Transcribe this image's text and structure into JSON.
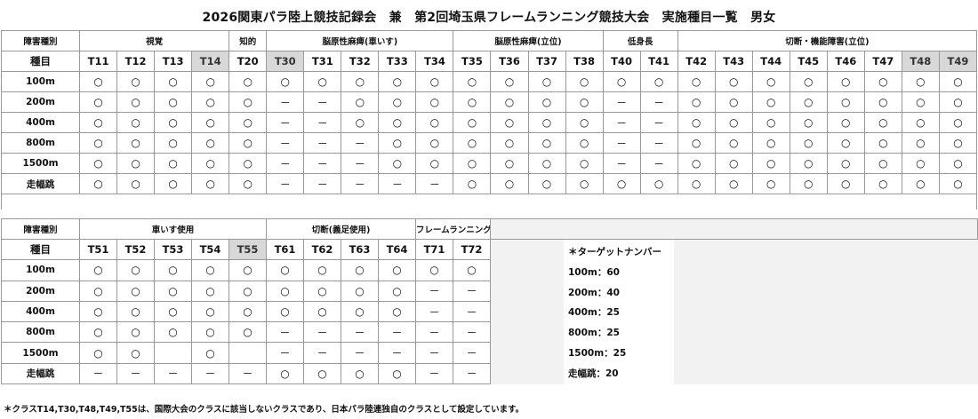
{
  "title": "2026関東パラ陸上競技記録会　兼　第2回埼玉県フレームランニング競技大会　実施種目一覧　男女",
  "labels": {
    "disability_type": "障害種別",
    "event": "種目"
  },
  "marks": {
    "yes": "○",
    "no": "－"
  },
  "table1": {
    "groups": [
      {
        "label": "視覚",
        "span": 4
      },
      {
        "label": "知的",
        "span": 1
      },
      {
        "label": "脳原性麻痺(車いす)",
        "span": 5
      },
      {
        "label": "脳原性麻痺(立位)",
        "span": 4
      },
      {
        "label": "低身長",
        "span": 2
      },
      {
        "label": "切断・機能障害(立位)",
        "span": 8
      }
    ],
    "classes": [
      {
        "label": "T11"
      },
      {
        "label": "T12"
      },
      {
        "label": "T13"
      },
      {
        "label": "T14",
        "gray": true
      },
      {
        "label": "T20"
      },
      {
        "label": "T30",
        "gray": true
      },
      {
        "label": "T31"
      },
      {
        "label": "T32"
      },
      {
        "label": "T33"
      },
      {
        "label": "T34"
      },
      {
        "label": "T35"
      },
      {
        "label": "T36"
      },
      {
        "label": "T37"
      },
      {
        "label": "T38"
      },
      {
        "label": "T40"
      },
      {
        "label": "T41"
      },
      {
        "label": "T42"
      },
      {
        "label": "T43"
      },
      {
        "label": "T44"
      },
      {
        "label": "T45"
      },
      {
        "label": "T46"
      },
      {
        "label": "T47"
      },
      {
        "label": "T48",
        "gray": true
      },
      {
        "label": "T49",
        "gray": true
      }
    ],
    "rows": [
      {
        "event": "100m",
        "cells": [
          "○",
          "○",
          "○",
          "○",
          "○",
          "○",
          "○",
          "○",
          "○",
          "○",
          "○",
          "○",
          "○",
          "○",
          "○",
          "○",
          "○",
          "○",
          "○",
          "○",
          "○",
          "○",
          "○",
          "○"
        ]
      },
      {
        "event": "200m",
        "cells": [
          "○",
          "○",
          "○",
          "○",
          "○",
          "－",
          "－",
          "○",
          "○",
          "○",
          "○",
          "○",
          "○",
          "○",
          "－",
          "－",
          "○",
          "○",
          "○",
          "○",
          "○",
          "○",
          "○",
          "○"
        ]
      },
      {
        "event": "400m",
        "cells": [
          "○",
          "○",
          "○",
          "○",
          "○",
          "－",
          "－",
          "○",
          "○",
          "○",
          "○",
          "○",
          "○",
          "○",
          "－",
          "－",
          "○",
          "○",
          "○",
          "○",
          "○",
          "○",
          "○",
          "○"
        ]
      },
      {
        "event": "800m",
        "cells": [
          "○",
          "○",
          "○",
          "○",
          "○",
          "－",
          "－",
          "－",
          "○",
          "○",
          "○",
          "○",
          "○",
          "○",
          "－",
          "－",
          "○",
          "○",
          "○",
          "○",
          "○",
          "○",
          "○",
          "○"
        ]
      },
      {
        "event": "1500m",
        "cells": [
          "○",
          "○",
          "○",
          "○",
          "○",
          "－",
          "－",
          "－",
          "○",
          "○",
          "○",
          "○",
          "○",
          "○",
          "－",
          "－",
          "○",
          "○",
          "○",
          "○",
          "○",
          "○",
          "○",
          "○"
        ]
      },
      {
        "event": "走幅跳",
        "cells": [
          "○",
          "○",
          "○",
          "○",
          "○",
          "－",
          "－",
          "－",
          "－",
          "－",
          "○",
          "○",
          "○",
          "○",
          "○",
          "○",
          "○",
          "○",
          "○",
          "○",
          "○",
          "○",
          "○",
          "○"
        ]
      }
    ]
  },
  "table2": {
    "groups": [
      {
        "label": "車いす使用",
        "span": 5
      },
      {
        "label": "切断(義足使用)",
        "span": 4
      },
      {
        "label": "フレームランニング",
        "span": 2
      }
    ],
    "classes": [
      {
        "label": "T51"
      },
      {
        "label": "T52"
      },
      {
        "label": "T53"
      },
      {
        "label": "T54"
      },
      {
        "label": "T55",
        "gray": true
      },
      {
        "label": "T61"
      },
      {
        "label": "T62"
      },
      {
        "label": "T63"
      },
      {
        "label": "T64"
      },
      {
        "label": "T71"
      },
      {
        "label": "T72"
      }
    ],
    "rows": [
      {
        "event": "100m",
        "cells": [
          "○",
          "○",
          "○",
          "○",
          "○",
          "○",
          "○",
          "○",
          "○",
          "○",
          "○"
        ]
      },
      {
        "event": "200m",
        "cells": [
          "○",
          "○",
          "○",
          "○",
          "○",
          "○",
          "○",
          "○",
          "○",
          "－",
          "－"
        ]
      },
      {
        "event": "400m",
        "cells": [
          "○",
          "○",
          "○",
          "○",
          "○",
          "○",
          "○",
          "○",
          "○",
          "－",
          "－"
        ]
      },
      {
        "event": "800m",
        "cells": [
          "○",
          "○",
          "○",
          "○",
          "○",
          "－",
          "－",
          "－",
          "－",
          "－",
          "－"
        ]
      },
      {
        "event": "1500m",
        "cells": [
          "○",
          "○",
          "",
          "○",
          "",
          "－",
          "－",
          "－",
          "－",
          "－",
          "－"
        ]
      },
      {
        "event": "走幅跳",
        "cells": [
          "－",
          "－",
          "－",
          "－",
          "－",
          "○",
          "○",
          "○",
          "○",
          "－",
          "－"
        ]
      }
    ]
  },
  "target_numbers": {
    "title": "＊ターゲットナンバー",
    "items": [
      "100m：60",
      "200m：40",
      "400m：25",
      "800m：25",
      "1500m：25",
      "走幅跳：20"
    ]
  },
  "footnote": "＊クラスT14,T30,T48,T49,T55は、国際大会のクラスに該当しないクラスであり、日本パラ陸連独自のクラスとして設定しています。"
}
